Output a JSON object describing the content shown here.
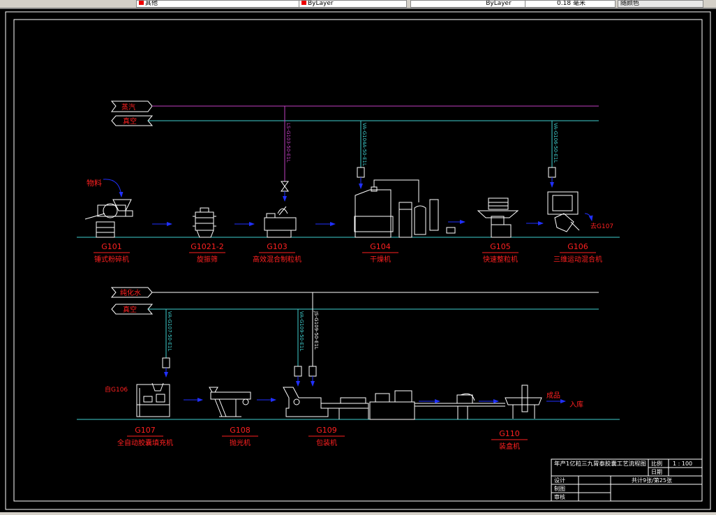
{
  "toolbar": {
    "layer": "其他",
    "color": "ByLayer",
    "linetype": "ByLayer",
    "lineweight": "0.18 毫米",
    "plotstyle": "随颜色"
  },
  "utilities": {
    "steam": "蒸汽",
    "vacuum1": "真空",
    "purified_water": "纯化水",
    "vacuum2": "真空"
  },
  "pipes": {
    "p1": "LS-G103-50-E1L",
    "p2": "VA-G104A-50-E1L",
    "p3": "VA-G106-50-E1L",
    "p4": "VA-G107-50-E1L",
    "p5": "VA-G109-50-E1L",
    "p6": "JS-G109-50-E1L"
  },
  "annotations": {
    "material": "物料",
    "to_g107": "去G107",
    "from_g106": "自G106",
    "product": "成品",
    "warehouse": "入库"
  },
  "equipment": [
    {
      "tag": "G101",
      "name": "锤式粉碎机"
    },
    {
      "tag": "G1021-2",
      "name": "旋振筛"
    },
    {
      "tag": "G103",
      "name": "高效混合制粒机"
    },
    {
      "tag": "G104",
      "name": "干燥机"
    },
    {
      "tag": "G105",
      "name": "快速整粒机"
    },
    {
      "tag": "G106",
      "name": "三维运动混合机"
    },
    {
      "tag": "G107",
      "name": "全自动胶囊填充机"
    },
    {
      "tag": "G108",
      "name": "抛光机"
    },
    {
      "tag": "G109",
      "name": "包装机"
    },
    {
      "tag": "G110",
      "name": "装盒机"
    }
  ],
  "title_block": {
    "title": "年产1亿粒三九胃泰胶囊工艺流程图",
    "scale_label": "比例",
    "scale": "1 : 100",
    "date_label": "日期",
    "design": "设计",
    "draw": "制图",
    "review": "审核",
    "sheets": "共计9张/第25张"
  },
  "colors": {
    "steam": "#c040c0",
    "vacuum": "#40d0d0",
    "water": "#ffffff",
    "label": "#ff2020",
    "arrow": "#2030ff"
  }
}
